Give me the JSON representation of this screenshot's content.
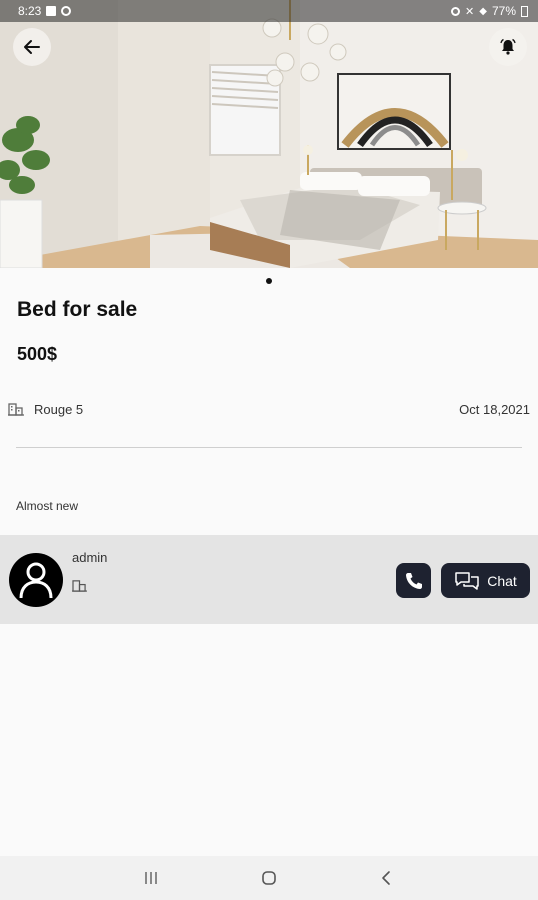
{
  "status_bar": {
    "time": "8:23",
    "battery": "77%"
  },
  "listing": {
    "title": "Bed for sale",
    "price": "500$",
    "location": "Rouge 5",
    "date": "Oct 18,2021",
    "description": "Almost new"
  },
  "seller": {
    "name": "admin"
  },
  "actions": {
    "chat_label": "Chat"
  },
  "colors": {
    "button_bg": "#1e2230",
    "panel_bg": "#e4e4e4"
  },
  "icons": [
    "back-arrow-icon",
    "bell-icon",
    "building-icon",
    "avatar-person-icon",
    "phone-icon",
    "chat-bubbles-icon",
    "recent-apps-icon",
    "home-icon",
    "nav-back-icon"
  ]
}
